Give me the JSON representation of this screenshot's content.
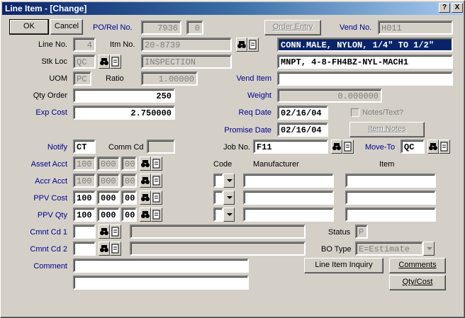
{
  "window": {
    "title": "Line Item - [Change]",
    "help_btn": "?",
    "close_btn": "X"
  },
  "buttons": {
    "ok": "OK",
    "cancel": "Cancel",
    "order_entry": "Order Entry",
    "item_notes": "Item Notes",
    "line_item_inquiry": "Line Item Inquiry",
    "comments": "Comments",
    "qty_cost": "Qty/Cost"
  },
  "labels": {
    "po_rel_no": "PO/Rel No.",
    "vend_no": "Vend No.",
    "line_no": "Line No.",
    "itm_no": "Itm No.",
    "stk_loc": "Stk Loc",
    "uom": "UOM",
    "ratio": "Ratio",
    "vend_item": "Vend Item",
    "qty_order": "Qty Order",
    "weight": "Weight",
    "exp_cost": "Exp Cost",
    "req_date": "Req Date",
    "notes_text": "Notes/Text?",
    "promise_date": "Promise Date",
    "notify": "Notify",
    "comm_cd": "Comm Cd",
    "job_no": "Job No.",
    "move_to": "Move-To",
    "asset_acct": "Asset Acct",
    "code": "Code",
    "manufacturer": "Manufacturer",
    "item": "Item",
    "accr_acct": "Accr Acct",
    "ppv_cost": "PPV Cost",
    "ppv_qty": "PPV Qty",
    "cmnt_cd_1": "Cmnt Cd 1",
    "status": "Status",
    "cmnt_cd_2": "Cmnt Cd 2",
    "bo_type": "BO Type",
    "comment": "Comment"
  },
  "values": {
    "po_no": "7936",
    "rel_no": "0",
    "vend_no": "H011",
    "line_no": "4",
    "itm_no": "20-8739",
    "desc1": "CONN.MALE, NYLON, 1/4\" TO 1/2\"",
    "desc2": "MNPT, 4-8-FH4BZ-NYL-MACH1",
    "stk_loc": "QC",
    "stk_loc_desc": "INSPECTION",
    "uom": "PC",
    "ratio": "1.00000",
    "vend_item": "",
    "qty_order": "250",
    "weight": "0.000000",
    "exp_cost": "2.750000",
    "req_date": "02/16/04",
    "promise_date": "02/16/04",
    "notify": "CT",
    "comm_cd": "",
    "job_no": "F11",
    "move_to": "QC",
    "asset_acct": [
      "100",
      "000",
      "00"
    ],
    "accr_acct": [
      "100",
      "000",
      "00"
    ],
    "ppv_cost": [
      "100",
      "000",
      "00"
    ],
    "ppv_qty": [
      "100",
      "000",
      "00"
    ],
    "cmnt_cd_1": "",
    "cmnt_cd_1_desc": "",
    "cmnt_cd_2": "",
    "cmnt_cd_2_desc": "",
    "status": "P",
    "bo_type": "E=Estimate",
    "comment1": "",
    "comment2": ""
  },
  "colors": {
    "title_start": "#0a246a",
    "title_end": "#a6caf0",
    "label_blue": "#00008b",
    "selection": "#0a246a"
  }
}
